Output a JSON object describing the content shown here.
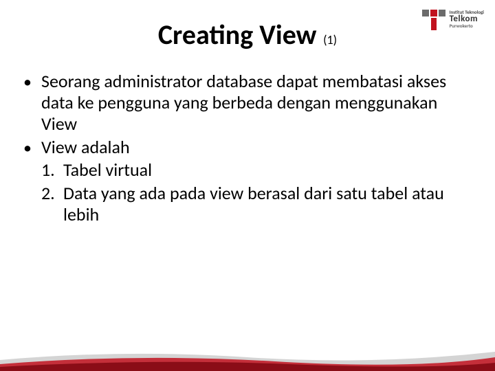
{
  "title": {
    "main": "Creating View",
    "sub": "(1)"
  },
  "bullets": [
    {
      "text": "Seorang administrator database dapat membatasi akses data ke pengguna yang berbeda dengan menggunakan View"
    },
    {
      "text": "View adalah",
      "subitems": [
        {
          "num": "1.",
          "text": "Tabel virtual"
        },
        {
          "num": "2.",
          "text": "Data yang ada pada view berasal dari satu tabel atau lebih"
        }
      ]
    }
  ],
  "logo": {
    "line1": "Institut Teknologi",
    "line2": "Telkom",
    "line3": "Purwokerto"
  }
}
